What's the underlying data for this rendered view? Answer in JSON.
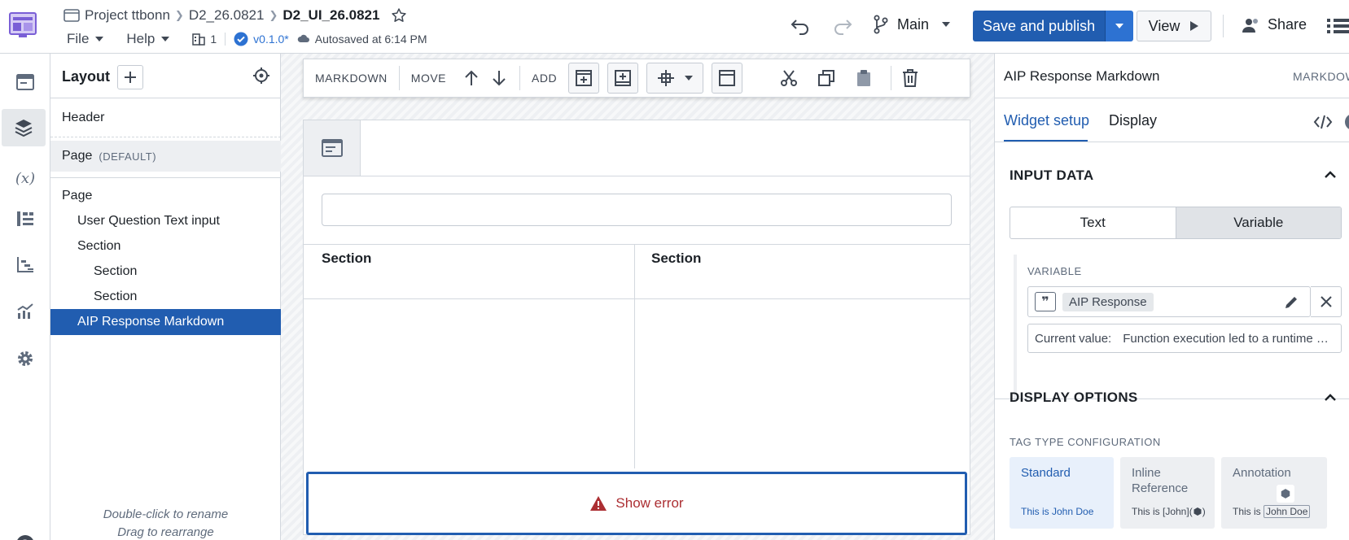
{
  "header": {
    "breadcrumb": [
      "Project ttbonn",
      "D2_26.0821",
      "D2_UI_26.0821"
    ],
    "menus": [
      "File",
      "Help"
    ],
    "org_count": "1",
    "version": "v0.1.0*",
    "autosave": "Autosaved at 6:14 PM",
    "branch": "Main",
    "save_label": "Save and publish",
    "view_label": "View",
    "share_label": "Share"
  },
  "layout_panel": {
    "title": "Layout",
    "header_item": "Header",
    "page_default_label": "Page",
    "page_default_tag": "(DEFAULT)",
    "tree": [
      {
        "label": "Page",
        "depth": 0
      },
      {
        "label": "User Question Text input",
        "depth": 1
      },
      {
        "label": "Section",
        "depth": 1
      },
      {
        "label": "Section",
        "depth": 2
      },
      {
        "label": "Section",
        "depth": 2
      },
      {
        "label": "AIP Response Markdown",
        "depth": 1,
        "selected": true
      }
    ],
    "hint_rename": "Double-click to rename",
    "hint_drag": "Drag to rearrange"
  },
  "canvas": {
    "toolbar": {
      "markdown": "MARKDOWN",
      "move": "MOVE",
      "add": "ADD"
    },
    "section_left": "Section",
    "section_right": "Section",
    "error_label": "Show error"
  },
  "right_panel": {
    "title": "AIP Response Markdown",
    "type_tag": "MARKDOWN",
    "tabs": [
      "Widget setup",
      "Display"
    ],
    "input_data": "INPUT DATA",
    "seg_text": "Text",
    "seg_variable": "Variable",
    "variable_label": "VARIABLE",
    "variable_value": "AIP Response",
    "current_value_label": "Current value:",
    "current_value": "Function execution led to a runtime …",
    "display_options": "DISPLAY OPTIONS",
    "tag_type_label": "TAG TYPE CONFIGURATION",
    "tag_types": [
      {
        "name": "Standard",
        "example": "This is John Doe"
      },
      {
        "name": "Inline Reference",
        "example": "This is [John]("
      },
      {
        "name": "Annotation",
        "example_prefix": "This is",
        "example_name": "John Doe"
      }
    ]
  },
  "colors": {
    "accent": "#215db0",
    "error": "#ac2f33",
    "selected_row": "#215db0"
  }
}
